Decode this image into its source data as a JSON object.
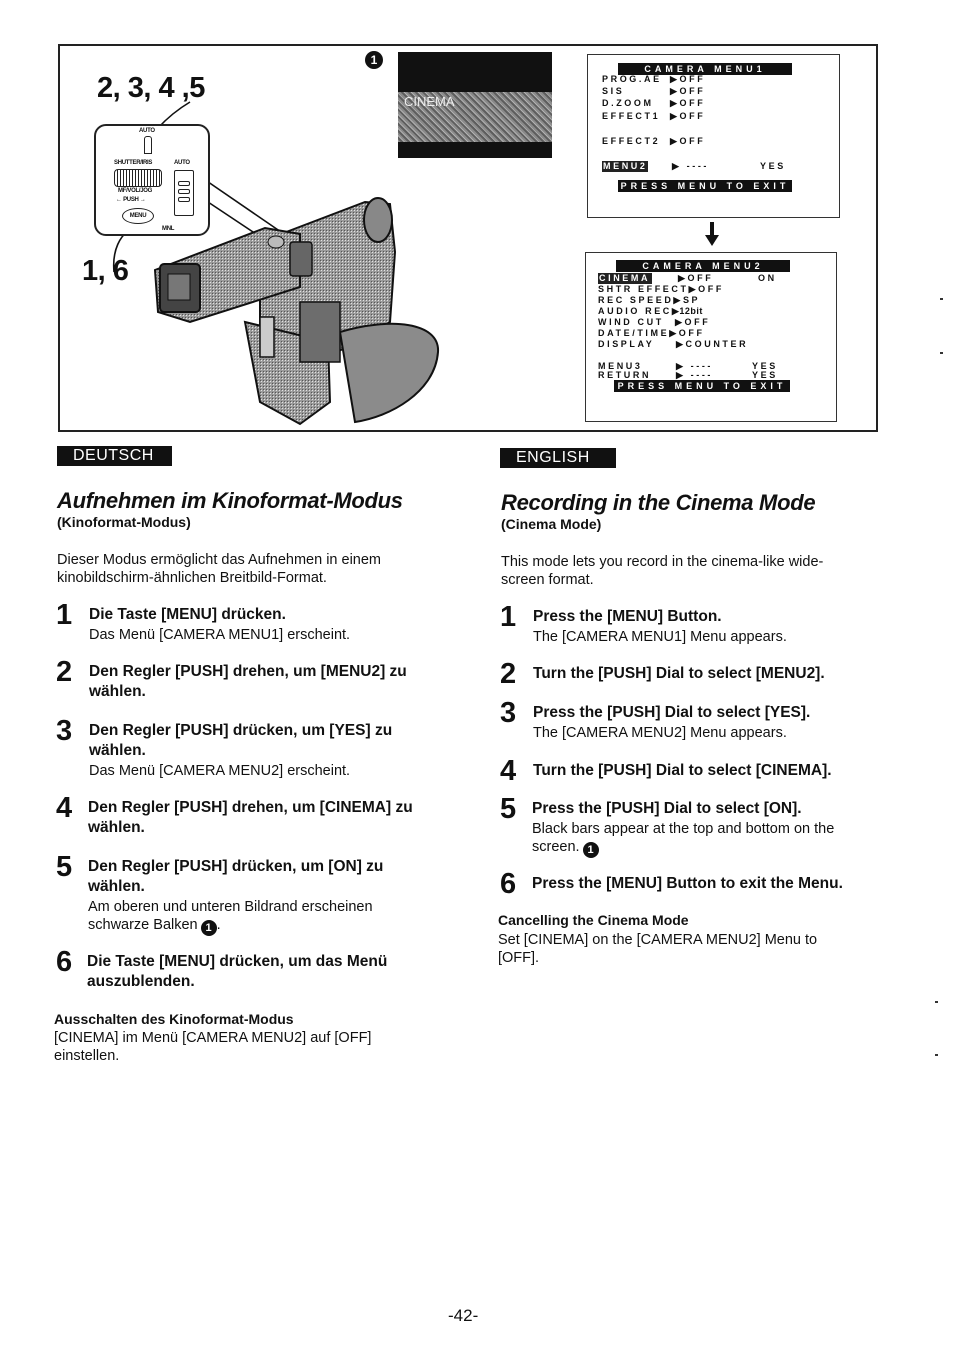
{
  "figure": {
    "step_labels_top": "2, 3, 4 ,5",
    "step_labels_bottom": "1, 6",
    "callout_marker": "1",
    "panel_labels": {
      "auto_top": "AUTO",
      "shutter_iris": "SHUTTER/IRIS",
      "auto_switch": "AUTO",
      "mf_vol_jog": "MF/VOL/JOG",
      "push": "PUSH",
      "menu_button": "MENU",
      "mnl": "MNL"
    },
    "screen_label": "CINEMA",
    "menu1": {
      "title": "CAMERA MENU1",
      "rows": [
        {
          "label": "PROG.AE",
          "value": "▶OFF"
        },
        {
          "label": "SIS",
          "value": "▶OFF"
        },
        {
          "label": "D.ZOOM",
          "value": "▶OFF"
        },
        {
          "label": "EFFECT1",
          "value": "▶OFF"
        },
        {
          "label": "EFFECT2",
          "value": "▶OFF"
        }
      ],
      "selected_row": {
        "label": "MENU2",
        "value": "▶ ----",
        "option": "YES"
      },
      "footer": "PRESS MENU TO EXIT"
    },
    "menu2": {
      "title": "CAMERA MENU2",
      "selected_row": {
        "label": "CINEMA",
        "value": "▶OFF",
        "option": "ON"
      },
      "rows": [
        {
          "label": "SHTR EFFECT",
          "value": "▶OFF"
        },
        {
          "label": "REC SPEED",
          "value": "▶SP"
        },
        {
          "label": "AUDIO REC",
          "value": "▶12bit"
        },
        {
          "label": "WIND CUT",
          "value": "▶OFF"
        },
        {
          "label": "DATE/TIME",
          "value": "▶OFF"
        },
        {
          "label": "DISPLAY",
          "value": "▶COUNTER"
        }
      ],
      "nav_rows": [
        {
          "label": "MENU3",
          "value": "▶ ----",
          "option": "YES"
        },
        {
          "label": "RETURN",
          "value": "▶ ----",
          "option": "YES"
        }
      ],
      "footer": "PRESS MENU TO EXIT"
    }
  },
  "deutsch": {
    "lang_label": "DEUTSCH",
    "title": "Aufnehmen im Kinoformat-Modus",
    "subtitle": "(Kinoformat-Modus)",
    "intro": "Dieser Modus ermöglicht das Aufnehmen in einem kinobildschirm-ähnlichen Breitbild-Format.",
    "steps": [
      {
        "num": "1",
        "head": "Die Taste [MENU] drücken.",
        "body": "Das Menü [CAMERA MENU1] erscheint."
      },
      {
        "num": "2",
        "head": "Den Regler [PUSH] drehen, um [MENU2] zu wählen.",
        "body": ""
      },
      {
        "num": "3",
        "head": "Den Regler [PUSH] drücken, um [YES] zu wählen.",
        "body": "Das Menü [CAMERA MENU2] erscheint."
      },
      {
        "num": "4",
        "head": "Den Regler [PUSH] drehen, um [CINEMA] zu wählen.",
        "body": ""
      },
      {
        "num": "5",
        "head": "Den Regler [PUSH] drücken, um [ON] zu wählen.",
        "body": "Am oberen und unteren Bildrand erscheinen schwarze Balken",
        "body_marker": "1",
        "body_suffix": "."
      },
      {
        "num": "6",
        "head": "Die Taste [MENU] drücken, um das Menü auszublenden.",
        "body": ""
      }
    ],
    "cancel_title": "Ausschalten des Kinoformat-Modus",
    "cancel_text": "[CINEMA] im Menü [CAMERA MENU2] auf [OFF] einstellen."
  },
  "english": {
    "lang_label": "ENGLISH",
    "title": "Recording in the Cinema Mode",
    "subtitle": "(Cinema Mode)",
    "intro": "This mode lets you record in the cinema-like wide-screen format.",
    "steps": [
      {
        "num": "1",
        "head": "Press the [MENU] Button.",
        "body": "The [CAMERA MENU1] Menu appears."
      },
      {
        "num": "2",
        "head": "Turn the [PUSH] Dial to select [MENU2].",
        "body": ""
      },
      {
        "num": "3",
        "head": "Press the [PUSH] Dial to select [YES].",
        "body": "The [CAMERA MENU2] Menu appears."
      },
      {
        "num": "4",
        "head": "Turn the [PUSH] Dial to select [CINEMA].",
        "body": ""
      },
      {
        "num": "5",
        "head": "Press the [PUSH] Dial to select [ON].",
        "body": "Black bars appear at the top and bottom on the screen.",
        "body_marker": "1"
      },
      {
        "num": "6",
        "head": "Press the [MENU] Button to exit the Menu.",
        "body": ""
      }
    ],
    "cancel_title": "Cancelling the Cinema Mode",
    "cancel_text": "Set [CINEMA] on the [CAMERA MENU2] Menu to [OFF]."
  },
  "page_number": "-42-"
}
